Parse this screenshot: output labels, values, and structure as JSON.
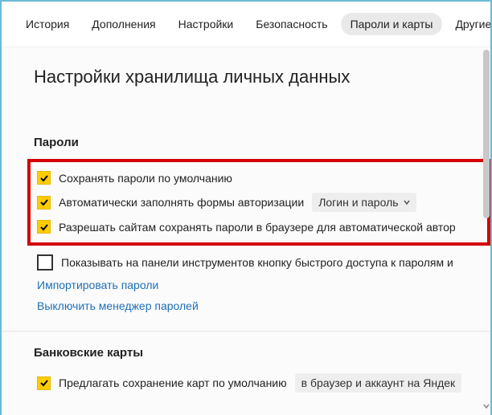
{
  "tabs": {
    "items": [
      {
        "label": "История"
      },
      {
        "label": "Дополнения"
      },
      {
        "label": "Настройки"
      },
      {
        "label": "Безопасность"
      },
      {
        "label": "Пароли и карты"
      },
      {
        "label": "Другие устр"
      }
    ],
    "active_index": 4
  },
  "page_title": "Настройки хранилища личных данных",
  "passwords": {
    "section_title": "Пароли",
    "save_by_default": "Сохранять пароли по умолчанию",
    "autofill_forms": "Автоматически заполнять формы авторизации",
    "autofill_select": "Логин и пароль",
    "allow_sites_save": "Разрешать сайтам сохранять пароли в браузере для автоматической автор",
    "show_quick_button": "Показывать на панели инструментов кнопку быстрого доступа к паролям и",
    "import_link": "Импортировать пароли",
    "disable_link": "Выключить менеджер паролей"
  },
  "cards": {
    "section_title": "Банковские карты",
    "offer_save": "Предлагать сохранение карт по умолчанию",
    "save_location": "в браузер и аккаунт на Яндек"
  }
}
